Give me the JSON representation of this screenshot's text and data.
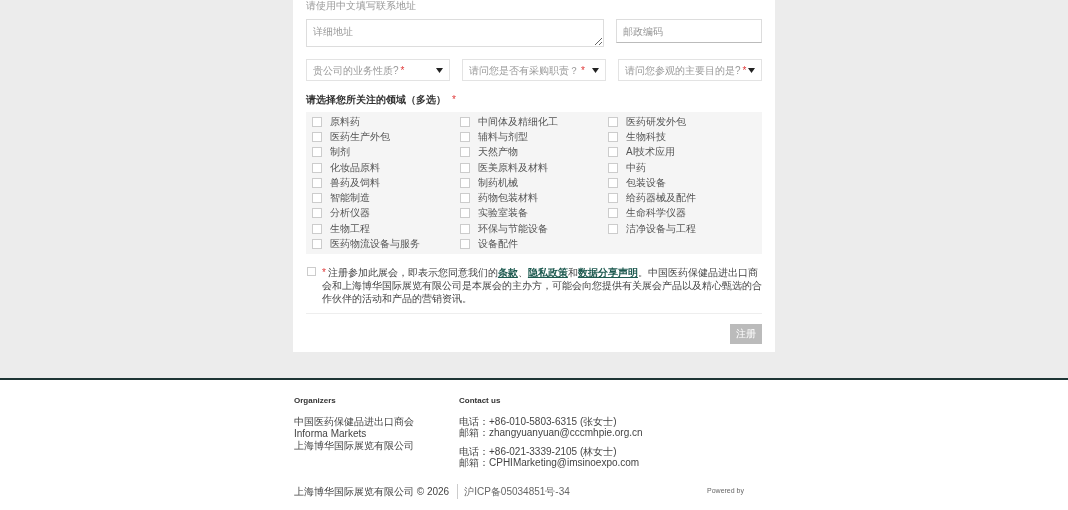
{
  "form": {
    "hint": "请使用中文填写联系地址",
    "address": {
      "placeholder": "详细地址"
    },
    "postcode": {
      "placeholder": "邮政编码"
    },
    "selects": [
      {
        "placeholder": "贵公司的业务性质?",
        "mark": "*"
      },
      {
        "placeholder": "请问您是否有采购职责？",
        "mark": "*"
      },
      {
        "placeholder": "请问您参观的主要目的是?",
        "mark": "*"
      }
    ],
    "interests": {
      "label": "请选择您所关注的领域（多选）",
      "mark": "*",
      "options": [
        {
          "label": "原料药",
          "checked": false
        },
        {
          "label": "中间体及精细化工",
          "checked": false
        },
        {
          "label": "医药研发外包",
          "checked": false
        },
        {
          "label": "医药生产外包",
          "checked": false
        },
        {
          "label": "辅料与剂型",
          "checked": false
        },
        {
          "label": "生物科技",
          "checked": false
        },
        {
          "label": "制剂",
          "checked": false
        },
        {
          "label": "天然产物",
          "checked": false
        },
        {
          "label": "AI技术应用",
          "checked": false
        },
        {
          "label": "化妆品原料",
          "checked": false
        },
        {
          "label": "医美原料及材料",
          "checked": false
        },
        {
          "label": "中药",
          "checked": false
        },
        {
          "label": "兽药及饲料",
          "checked": false
        },
        {
          "label": "制药机械",
          "checked": false
        },
        {
          "label": "包装设备",
          "checked": false
        },
        {
          "label": "智能制造",
          "checked": false
        },
        {
          "label": "药物包装材料",
          "checked": false
        },
        {
          "label": "给药器械及配件",
          "checked": false
        },
        {
          "label": "分析仪器",
          "checked": false
        },
        {
          "label": "实验室装备",
          "checked": false
        },
        {
          "label": "生命科学仪器",
          "checked": false
        },
        {
          "label": "生物工程",
          "checked": false
        },
        {
          "label": "环保与节能设备",
          "checked": false
        },
        {
          "label": "洁净设备与工程",
          "checked": false
        },
        {
          "label": "医药物流设备与服务",
          "checked": false
        },
        {
          "label": "设备配件",
          "checked": false
        }
      ]
    },
    "consent": {
      "checked": false,
      "mark": "*",
      "parts": [
        {
          "kind": "text",
          "text": "注册参加此展会，即表示您同意我们的"
        },
        {
          "kind": "link",
          "text": "条款"
        },
        {
          "kind": "text",
          "text": "、"
        },
        {
          "kind": "link",
          "text": "隐私政策"
        },
        {
          "kind": "text",
          "text": "和"
        },
        {
          "kind": "link",
          "text": "数据分享声明"
        },
        {
          "kind": "text",
          "text": "。中国医药保健品进出口商会和上海博华国际展览有限公司是本展会的主办方，可能会向您提供有关展会产品以及精心甄选的合作伙伴的活动和产品的营销资讯。"
        }
      ]
    },
    "submit": {
      "label": "注册",
      "disabled": true
    }
  },
  "footer": {
    "organizers": {
      "title": "Organizers",
      "items": [
        "中国医药保健品进出口商会",
        "Informa Markets",
        "上海博华国际展览有限公司"
      ]
    },
    "contact": {
      "title": "Contact us",
      "groups": [
        [
          "电话：+86-010-5803-6315 (张女士)",
          "邮箱：zhangyuanyuan@cccmhpie.org.cn"
        ],
        [
          "电话：+86-021-3339-2105 (林女士)",
          "邮箱：CPHIMarketing@imsinoexpo.com"
        ]
      ]
    },
    "copyright": "上海博华国际展览有限公司 © 2026",
    "icp": "沪ICP备05034851号-34",
    "powered_by": "Powered by"
  }
}
